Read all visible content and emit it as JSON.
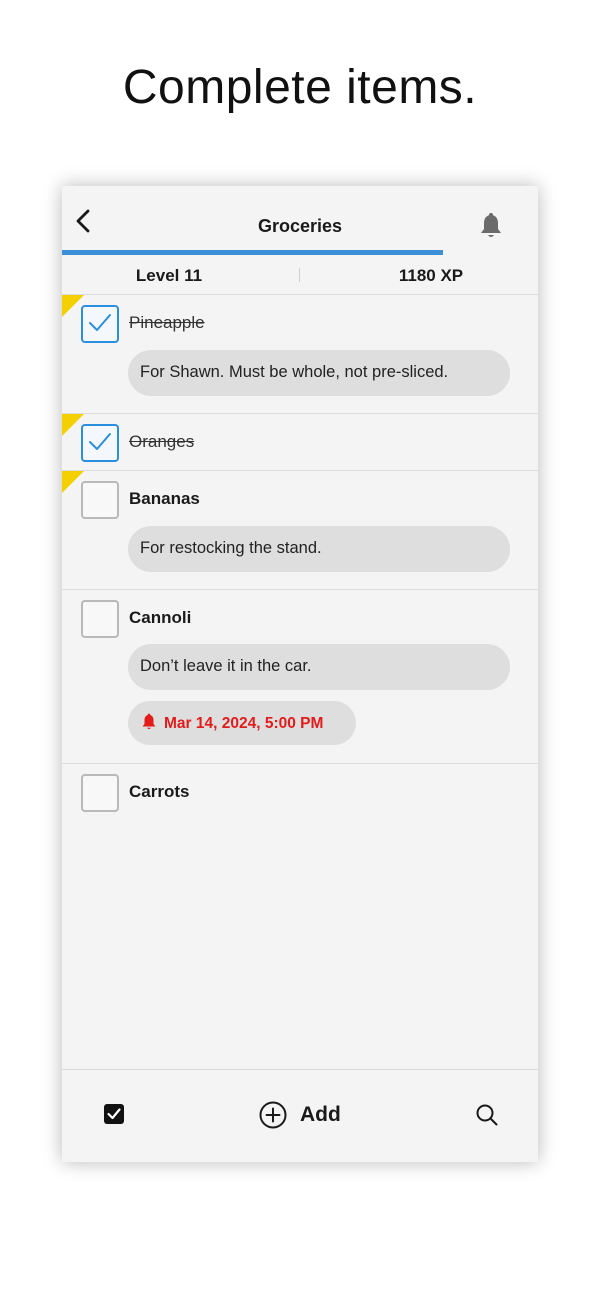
{
  "headline": "Complete items.",
  "nav": {
    "title": "Groceries",
    "back_icon": "chevron-left-icon",
    "bell_icon": "bell-icon"
  },
  "progress": {
    "fraction": 0.8,
    "color": "#3b90d8"
  },
  "stats": {
    "level": "Level 11",
    "xp": "1180 XP"
  },
  "items": [
    {
      "title": "Pineapple",
      "checked": true,
      "flagged": true,
      "note": "For Shawn. Must be whole, not pre-sliced."
    },
    {
      "title": "Oranges",
      "checked": true,
      "flagged": true
    },
    {
      "title": "Bananas",
      "checked": false,
      "flagged": true,
      "note": "For restocking the stand."
    },
    {
      "title": "Cannoli",
      "checked": false,
      "flagged": false,
      "note": "Don’t leave it in the car.",
      "reminder": "Mar 14, 2024, 5:00 PM"
    },
    {
      "title": "Carrots",
      "checked": false,
      "flagged": false
    }
  ],
  "tabbar": {
    "add_label": "Add",
    "check_icon": "checkbox-icon",
    "add_icon": "plus-circle-icon",
    "search_icon": "search-icon"
  },
  "colors": {
    "accent": "#2b8fe0",
    "flag": "#f5d000",
    "reminder": "#e31b1b"
  }
}
